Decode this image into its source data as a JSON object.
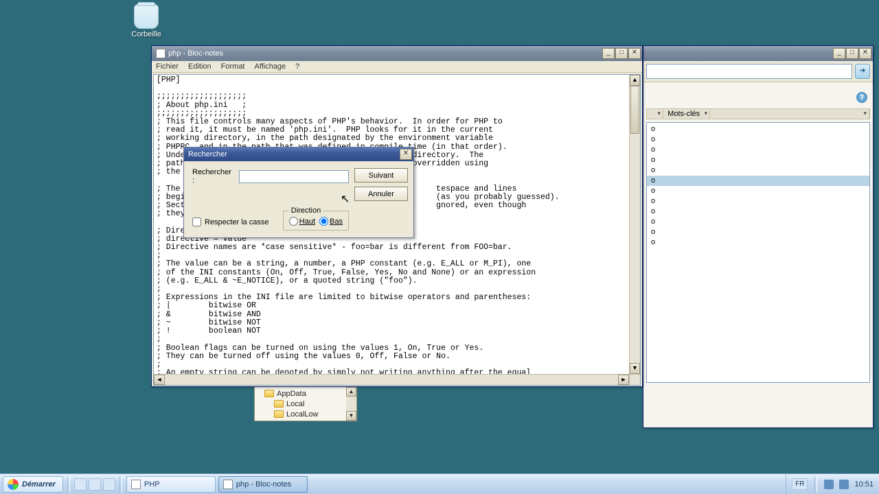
{
  "desktop": {
    "recycle_label": "Corbeille"
  },
  "notepad": {
    "title": "php - Bloc-notes",
    "menu": {
      "file": "Fichier",
      "edit": "Edition",
      "format": "Format",
      "view": "Affichage",
      "help": "?"
    },
    "content": "[PHP]\n\n;;;;;;;;;;;;;;;;;;;\n; About php.ini   ;\n;;;;;;;;;;;;;;;;;;;\n; This file controls many aspects of PHP's behavior.  In order for PHP to\n; read it, it must be named 'php.ini'.  PHP looks for it in the current\n; working directory, in the path designated by the environment variable\n; PHPRC, and in the path that was defined in compile time (in that order).\n; Under Windows, the compile-time path is the Windows directory.  The\n; path in which the php.ini file is looked for can be overridden using\n; the\n\n; The                                                      tespace and lines\n; begi                                                     (as you probably guessed).\n; Sect                                                     gnored, even though\n; they\n\n; Directives are specified using the following syntax:\n; directive = value\n; Directive names are *case sensitive* - foo=bar is different from FOO=bar.\n;\n; The value can be a string, a number, a PHP constant (e.g. E_ALL or M_PI), one\n; of the INI constants (On, Off, True, False, Yes, No and None) or an expression\n; (e.g. E_ALL & ~E_NOTICE), or a quoted string (\"foo\").\n;\n; Expressions in the INI file are limited to bitwise operators and parentheses:\n; |        bitwise OR\n; &        bitwise AND\n; ~        bitwise NOT\n; !        boolean NOT\n;\n; Boolean flags can be turned on using the values 1, On, True or Yes.\n; They can be turned off using the values 0, Off, False or No.\n;\n; An empty string can be denoted by simply not writing anything after the equal"
  },
  "find": {
    "title": "Rechercher",
    "label": "Rechercher :",
    "value": "",
    "next": "Suivant",
    "cancel": "Annuler",
    "direction_legend": "Direction",
    "up": "Haut",
    "down": "Bas",
    "down_selected": true,
    "match_case": "Respecter la casse",
    "match_case_checked": false
  },
  "bgwin": {
    "keywords_label": "Mots-clés",
    "help_symbol": "?",
    "go_symbol": "➜",
    "list": [
      "o",
      "o",
      "o",
      "o",
      "o",
      "o",
      "o",
      "o",
      "o",
      "o",
      "o",
      "o"
    ],
    "selected_index": 5
  },
  "tree": {
    "items": [
      "AppData",
      "Local",
      "LocalLow"
    ]
  },
  "taskbar": {
    "start": "Démarrer",
    "tasks": [
      {
        "label": "PHP",
        "active": false
      },
      {
        "label": "php - Bloc-notes",
        "active": true
      }
    ],
    "lang": "FR",
    "clock": "10:51"
  }
}
